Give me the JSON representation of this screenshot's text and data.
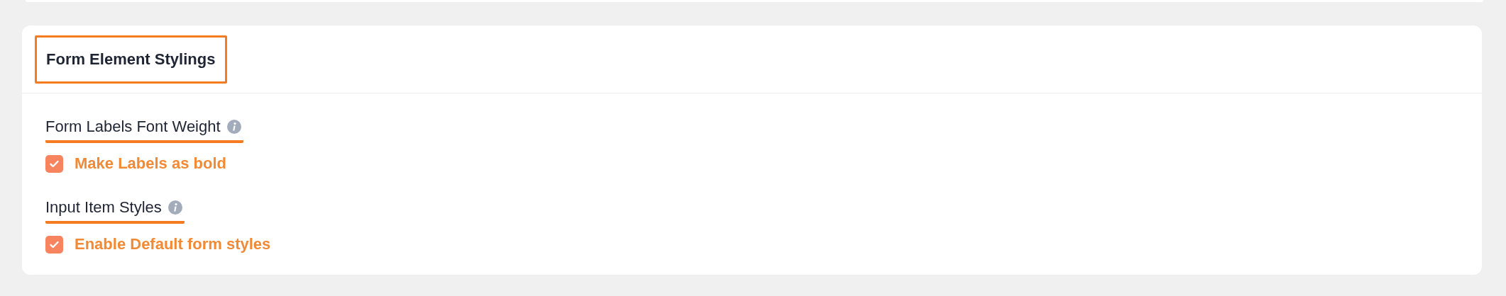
{
  "section": {
    "title": "Form Element Stylings",
    "highlighted": true
  },
  "settings": [
    {
      "label": "Form Labels Font Weight",
      "highlighted": true,
      "option": "Make Labels as bold",
      "checked": true
    },
    {
      "label": "Input Item Styles",
      "highlighted": true,
      "option": "Enable Default form styles",
      "checked": true
    }
  ]
}
